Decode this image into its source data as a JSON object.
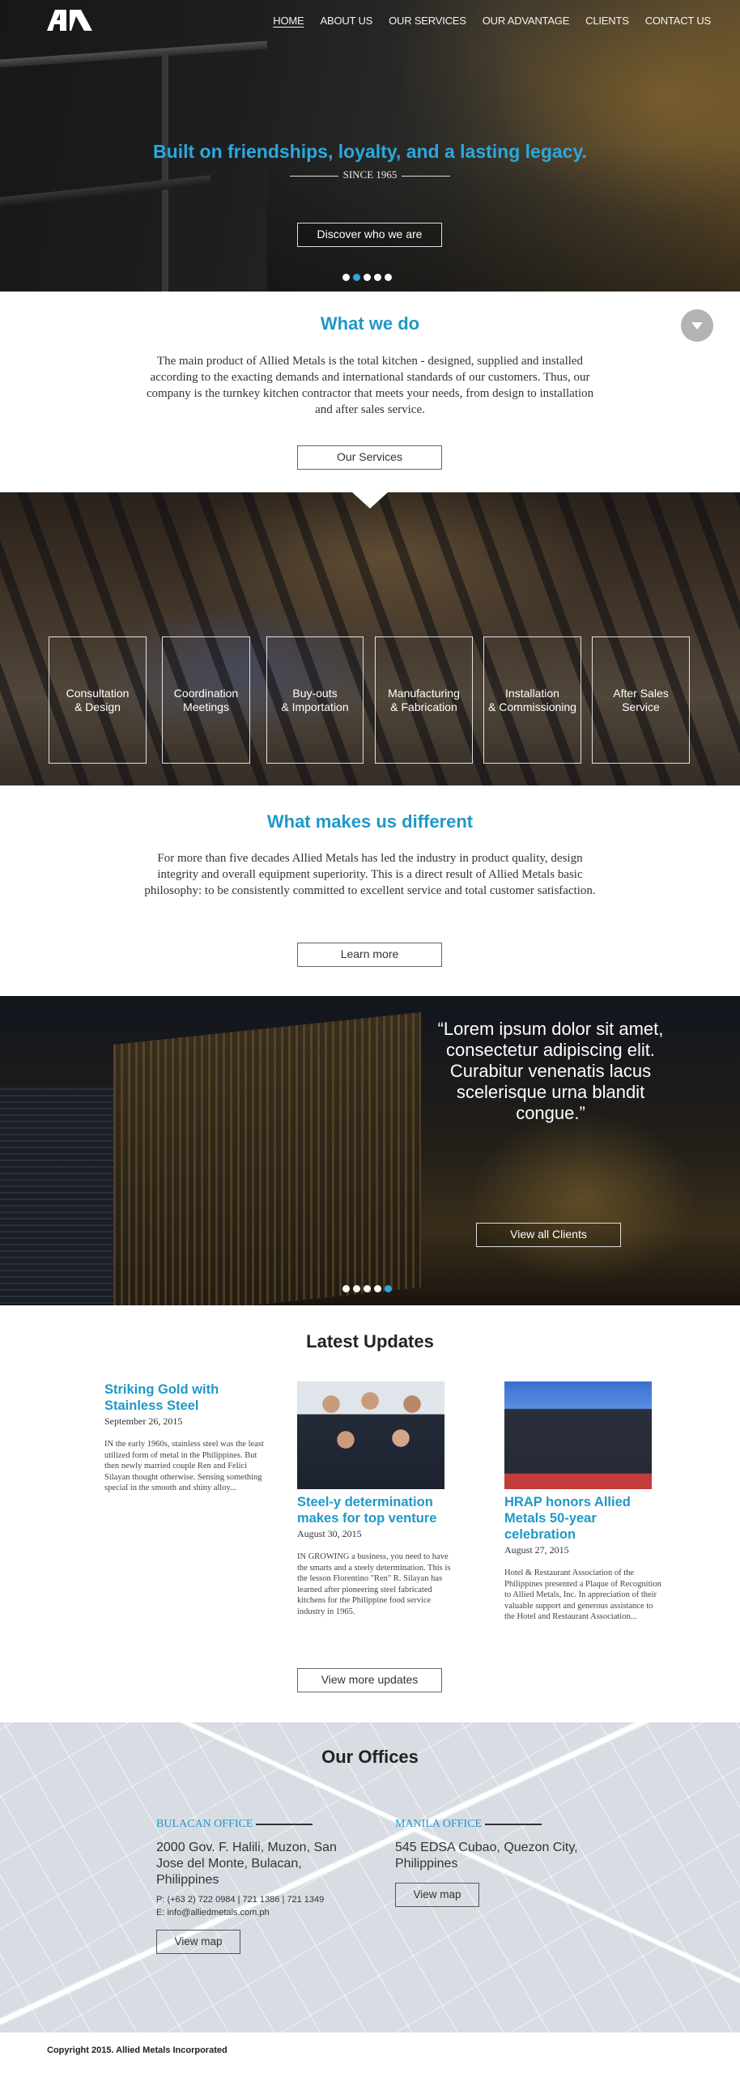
{
  "nav": {
    "logo_alt": "Allied Metals logo",
    "items": [
      {
        "label": "HOME",
        "active": true
      },
      {
        "label": "ABOUT US",
        "active": false
      },
      {
        "label": "OUR SERVICES",
        "active": false
      },
      {
        "label": "OUR ADVANTAGE",
        "active": false
      },
      {
        "label": "CLIENTS",
        "active": false
      },
      {
        "label": "CONTACT US",
        "active": false
      }
    ]
  },
  "hero": {
    "title": "Built on friendships, loyalty, and a lasting legacy.",
    "since": "SINCE 1965",
    "cta": "Discover who we are",
    "slides": 5,
    "active_slide": 2,
    "accent_color": "#29a9df"
  },
  "what_we_do": {
    "title": "What we do",
    "body": "The main product of Allied Metals is the total kitchen - designed, supplied and installed according to the exacting demands and international standards of our customers. Thus, our company is the turnkey kitchen contractor that meets your needs, from design to installation and after sales service.",
    "cta": "Our Services",
    "scroll_icon": "chevron-down-icon"
  },
  "services": [
    {
      "line1": "Consultation",
      "line2": "& Design"
    },
    {
      "line1": "Coordination",
      "line2": "Meetings"
    },
    {
      "line1": "Buy-outs",
      "line2": "& Importation"
    },
    {
      "line1": "Manufacturing",
      "line2": "& Fabrication"
    },
    {
      "line1": "Installation",
      "line2": "& Commissioning"
    },
    {
      "line1": "After Sales",
      "line2": "Service"
    }
  ],
  "different": {
    "title": "What makes us different",
    "body": "For more than five decades Allied Metals has led the industry in product quality, design integrity and overall equipment superiority. This is a direct result of Allied Metals basic philosophy: to be consistently committed to excellent service and total customer satisfaction.",
    "cta": "Learn more"
  },
  "clients": {
    "quote": "“Lorem ipsum dolor sit amet, consectetur adipiscing elit. Curabitur venenatis lacus scelerisque urna blandit congue.”",
    "cta": "View all Clients",
    "slides": 5,
    "active_slide": 5
  },
  "updates": {
    "title": "Latest Updates",
    "posts": [
      {
        "title": "Striking Gold with Stainless Steel",
        "date": "September 26, 2015",
        "excerpt": "IN the early 1960s, stainless steel was the least utilized form of metal in the Philippines. But then newly married couple Ren and Felici Silayan thought otherwise. Sensing something special in the smooth and shiny alloy...",
        "has_image": false
      },
      {
        "title": "Steel-y determination makes for top venture",
        "date": "August 30, 2015",
        "excerpt": "IN GROWING a business, you need to have the smarts and a steely determination. This is the lesson Florentino \"Ren\" R. Silayan has learned after pioneering steel fabricated kitchens for the Philippine food service industry in 1965.",
        "has_image": true
      },
      {
        "title": "HRAP honors Allied Metals 50-year celebration",
        "date": "August 27, 2015",
        "excerpt": "Hotel & Restaurant Association of the Philippines presented a Plaque of Recognition to Allied Metals, Inc. In appreciation of their valuable support and generous assistance to the Hotel and Restaurant Association...",
        "has_image": true
      }
    ],
    "cta": "View more updates"
  },
  "offices": {
    "title": "Our Offices",
    "list": [
      {
        "label": "BULACAN OFFICE",
        "address": "2000 Gov. F. Halili, Muzon, San Jose del Monte, Bulacan, Philippines",
        "phone": "P: (+63 2) 722 0984 | 721 1386 | 721 1349",
        "email": "E: info@alliedmetals.com.ph",
        "cta": "View map"
      },
      {
        "label": "MANILA OFFICE",
        "address": "545 EDSA Cubao, Quezon City, Philippines",
        "cta": "View map"
      }
    ]
  },
  "footer": {
    "copyright": "Copyright 2015. Allied Metals Incorporated"
  }
}
